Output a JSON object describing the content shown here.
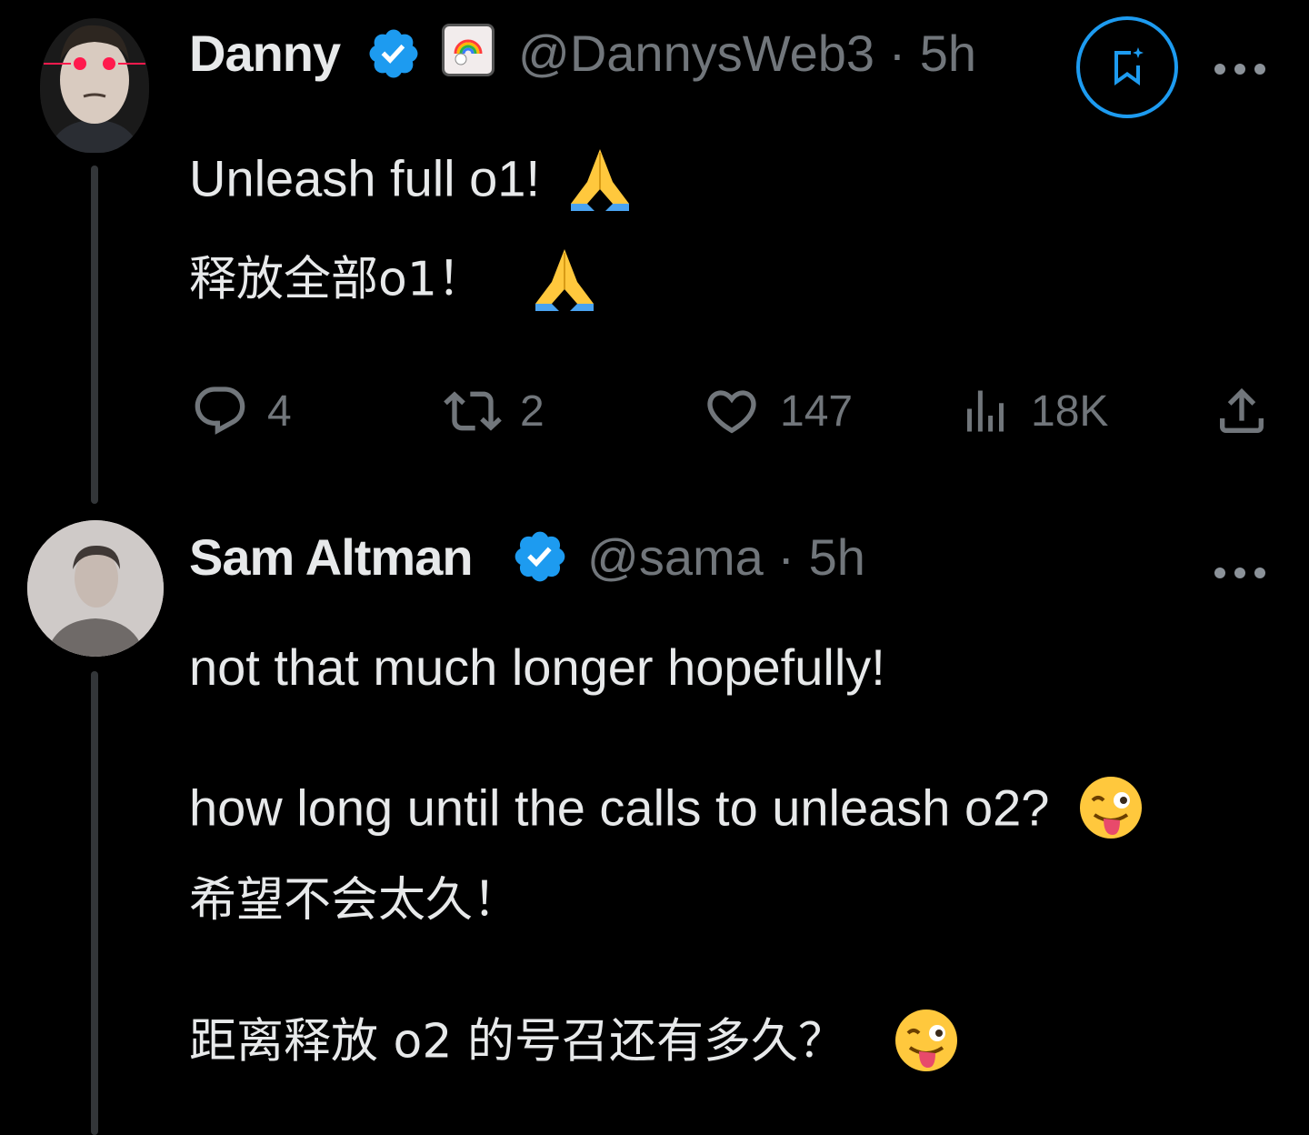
{
  "post1": {
    "author_name": "Danny",
    "handle": "@DannysWeb3",
    "time": "5h",
    "separator": "·",
    "lines": [
      "Unleash full o1!",
      "释放全部o1！"
    ],
    "actions": {
      "replies": "4",
      "reposts": "2",
      "likes": "147",
      "views": "18K"
    }
  },
  "post2": {
    "author_name": "Sam Altman",
    "handle": "@sama",
    "time": "5h",
    "separator": "·",
    "lines": [
      "not that much longer hopefully!",
      "how long until the calls to unleash o2?",
      "希望不会太久！",
      "距离释放 o2 的号召还有多久？"
    ]
  },
  "colors": {
    "background": "#000000",
    "text": "#e7e9ea",
    "secondary": "#71767b",
    "verified": "#1d9bf0",
    "grok_ring": "#1d9bf0"
  },
  "icons": [
    "verified-badge-icon",
    "grok-bookmark-icon",
    "more-icon",
    "reply-icon",
    "repost-icon",
    "like-icon",
    "views-icon",
    "share-icon",
    "folded-hands-emoji",
    "winking-tongue-emoji"
  ]
}
